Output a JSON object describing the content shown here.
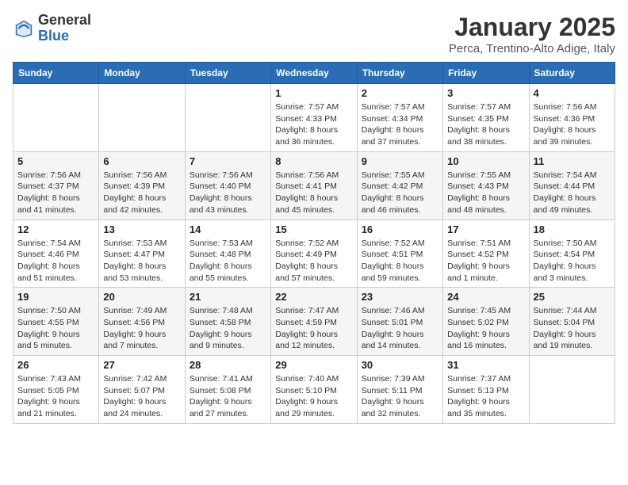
{
  "logo": {
    "general": "General",
    "blue": "Blue"
  },
  "title": "January 2025",
  "subtitle": "Perca, Trentino-Alto Adige, Italy",
  "weekdays": [
    "Sunday",
    "Monday",
    "Tuesday",
    "Wednesday",
    "Thursday",
    "Friday",
    "Saturday"
  ],
  "weeks": [
    [
      {
        "day": "",
        "info": ""
      },
      {
        "day": "",
        "info": ""
      },
      {
        "day": "",
        "info": ""
      },
      {
        "day": "1",
        "info": "Sunrise: 7:57 AM\nSunset: 4:33 PM\nDaylight: 8 hours and 36 minutes."
      },
      {
        "day": "2",
        "info": "Sunrise: 7:57 AM\nSunset: 4:34 PM\nDaylight: 8 hours and 37 minutes."
      },
      {
        "day": "3",
        "info": "Sunrise: 7:57 AM\nSunset: 4:35 PM\nDaylight: 8 hours and 38 minutes."
      },
      {
        "day": "4",
        "info": "Sunrise: 7:56 AM\nSunset: 4:36 PM\nDaylight: 8 hours and 39 minutes."
      }
    ],
    [
      {
        "day": "5",
        "info": "Sunrise: 7:56 AM\nSunset: 4:37 PM\nDaylight: 8 hours and 41 minutes."
      },
      {
        "day": "6",
        "info": "Sunrise: 7:56 AM\nSunset: 4:39 PM\nDaylight: 8 hours and 42 minutes."
      },
      {
        "day": "7",
        "info": "Sunrise: 7:56 AM\nSunset: 4:40 PM\nDaylight: 8 hours and 43 minutes."
      },
      {
        "day": "8",
        "info": "Sunrise: 7:56 AM\nSunset: 4:41 PM\nDaylight: 8 hours and 45 minutes."
      },
      {
        "day": "9",
        "info": "Sunrise: 7:55 AM\nSunset: 4:42 PM\nDaylight: 8 hours and 46 minutes."
      },
      {
        "day": "10",
        "info": "Sunrise: 7:55 AM\nSunset: 4:43 PM\nDaylight: 8 hours and 48 minutes."
      },
      {
        "day": "11",
        "info": "Sunrise: 7:54 AM\nSunset: 4:44 PM\nDaylight: 8 hours and 49 minutes."
      }
    ],
    [
      {
        "day": "12",
        "info": "Sunrise: 7:54 AM\nSunset: 4:46 PM\nDaylight: 8 hours and 51 minutes."
      },
      {
        "day": "13",
        "info": "Sunrise: 7:53 AM\nSunset: 4:47 PM\nDaylight: 8 hours and 53 minutes."
      },
      {
        "day": "14",
        "info": "Sunrise: 7:53 AM\nSunset: 4:48 PM\nDaylight: 8 hours and 55 minutes."
      },
      {
        "day": "15",
        "info": "Sunrise: 7:52 AM\nSunset: 4:49 PM\nDaylight: 8 hours and 57 minutes."
      },
      {
        "day": "16",
        "info": "Sunrise: 7:52 AM\nSunset: 4:51 PM\nDaylight: 8 hours and 59 minutes."
      },
      {
        "day": "17",
        "info": "Sunrise: 7:51 AM\nSunset: 4:52 PM\nDaylight: 9 hours and 1 minute."
      },
      {
        "day": "18",
        "info": "Sunrise: 7:50 AM\nSunset: 4:54 PM\nDaylight: 9 hours and 3 minutes."
      }
    ],
    [
      {
        "day": "19",
        "info": "Sunrise: 7:50 AM\nSunset: 4:55 PM\nDaylight: 9 hours and 5 minutes."
      },
      {
        "day": "20",
        "info": "Sunrise: 7:49 AM\nSunset: 4:56 PM\nDaylight: 9 hours and 7 minutes."
      },
      {
        "day": "21",
        "info": "Sunrise: 7:48 AM\nSunset: 4:58 PM\nDaylight: 9 hours and 9 minutes."
      },
      {
        "day": "22",
        "info": "Sunrise: 7:47 AM\nSunset: 4:59 PM\nDaylight: 9 hours and 12 minutes."
      },
      {
        "day": "23",
        "info": "Sunrise: 7:46 AM\nSunset: 5:01 PM\nDaylight: 9 hours and 14 minutes."
      },
      {
        "day": "24",
        "info": "Sunrise: 7:45 AM\nSunset: 5:02 PM\nDaylight: 9 hours and 16 minutes."
      },
      {
        "day": "25",
        "info": "Sunrise: 7:44 AM\nSunset: 5:04 PM\nDaylight: 9 hours and 19 minutes."
      }
    ],
    [
      {
        "day": "26",
        "info": "Sunrise: 7:43 AM\nSunset: 5:05 PM\nDaylight: 9 hours and 21 minutes."
      },
      {
        "day": "27",
        "info": "Sunrise: 7:42 AM\nSunset: 5:07 PM\nDaylight: 9 hours and 24 minutes."
      },
      {
        "day": "28",
        "info": "Sunrise: 7:41 AM\nSunset: 5:08 PM\nDaylight: 9 hours and 27 minutes."
      },
      {
        "day": "29",
        "info": "Sunrise: 7:40 AM\nSunset: 5:10 PM\nDaylight: 9 hours and 29 minutes."
      },
      {
        "day": "30",
        "info": "Sunrise: 7:39 AM\nSunset: 5:11 PM\nDaylight: 9 hours and 32 minutes."
      },
      {
        "day": "31",
        "info": "Sunrise: 7:37 AM\nSunset: 5:13 PM\nDaylight: 9 hours and 35 minutes."
      },
      {
        "day": "",
        "info": ""
      }
    ]
  ]
}
